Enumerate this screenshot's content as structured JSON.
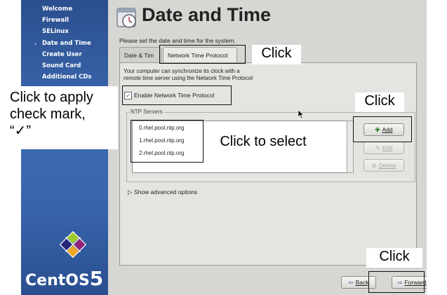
{
  "sidebar": {
    "items": [
      {
        "label": "Welcome"
      },
      {
        "label": "Firewall"
      },
      {
        "label": "SELinux"
      },
      {
        "label": "Date and Time",
        "current": true
      },
      {
        "label": "Create User"
      },
      {
        "label": "Sound Card"
      },
      {
        "label": "Additional CDs"
      }
    ],
    "current_marker": "›",
    "logo_text": "CentOS",
    "logo_number": "5"
  },
  "header": {
    "title": "Date and Time",
    "subtitle": "Please set the date and time for the system."
  },
  "tabs": [
    {
      "label": "Date & Tim",
      "active": false
    },
    {
      "label": "Network Time Protocol",
      "active": true
    }
  ],
  "ntp": {
    "description_line1": "Your computer can synchronize its clock with a",
    "description_line2": "remote time server using the Network Time Protocol",
    "enable_label": "Enable Network Time Protocol",
    "enable_checked": true,
    "servers_group_label": "NTP Servers",
    "servers": [
      "0.rhel.pool.ntp.org",
      "1.rhel.pool.ntp.org",
      "2.rhel.pool.ntp.org"
    ],
    "add_label": "Add",
    "edit_label": "Edit",
    "delete_label": "Delete",
    "advanced_label": "Show advanced options"
  },
  "footer": {
    "back_label": "Back",
    "forward_label": "Forward"
  },
  "annotations": {
    "click_tab": "Click",
    "click_add": "Click",
    "click_forward": "Click",
    "click_select": "Click to select",
    "apply_line1": "Click to apply",
    "apply_line2": "check mark,",
    "apply_line3": "“✓”"
  },
  "colors": {
    "sidebar": "#3e6bb3",
    "background": "#d6d6d3"
  }
}
